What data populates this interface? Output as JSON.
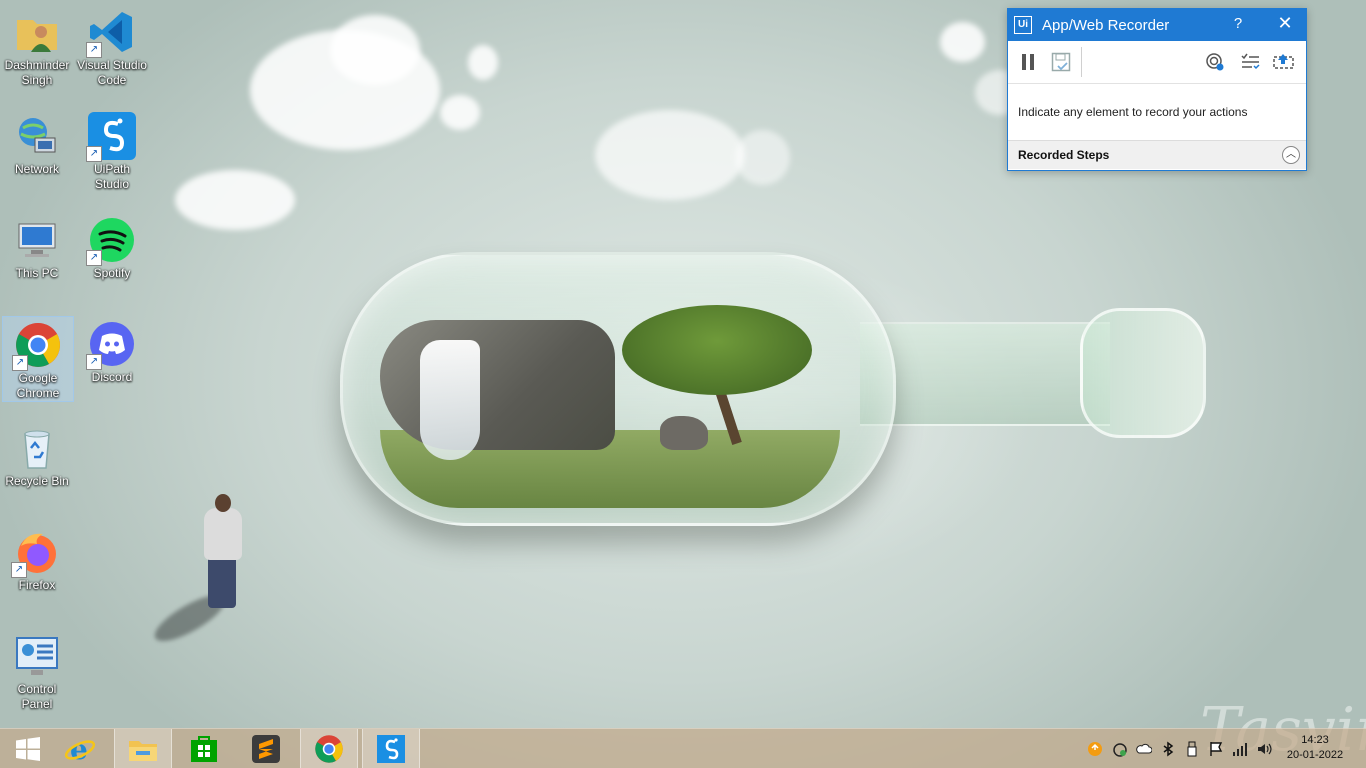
{
  "desktop": {
    "icons": [
      {
        "label": "Dashminder Singh",
        "icon": "user-folder-icon"
      },
      {
        "label": "Visual Studio Code",
        "icon": "vscode-icon"
      },
      {
        "label": "Network",
        "icon": "network-icon"
      },
      {
        "label": "UiPath Studio",
        "icon": "uipath-studio-icon"
      },
      {
        "label": "This PC",
        "icon": "this-pc-icon"
      },
      {
        "label": "Spotify",
        "icon": "spotify-icon"
      },
      {
        "label": "Google Chrome",
        "icon": "chrome-icon"
      },
      {
        "label": "Discord",
        "icon": "discord-icon"
      },
      {
        "label": "Recycle Bin",
        "icon": "recycle-bin-icon"
      },
      {
        "label": "Firefox",
        "icon": "firefox-icon"
      },
      {
        "label": "Control Panel",
        "icon": "control-panel-icon"
      }
    ],
    "selected_icon": "Google Chrome",
    "watermark": "Tasvir"
  },
  "recorder": {
    "title": "App/Web Recorder",
    "logo": "Ui",
    "help": "?",
    "close": "✕",
    "toolbar": [
      {
        "name": "pause",
        "icon": "pause-icon"
      },
      {
        "name": "save",
        "icon": "save-icon"
      },
      {
        "name": "target-settings",
        "icon": "target-icon"
      },
      {
        "name": "options",
        "icon": "list-options-icon"
      },
      {
        "name": "screen-selection",
        "icon": "screen-select-icon"
      }
    ],
    "message": "Indicate any element to record your actions",
    "recorded_steps_label": "Recorded Steps",
    "collapse": "︿",
    "accent": "#1f7ad3"
  },
  "taskbar": {
    "apps": [
      {
        "name": "start",
        "icon": "windows-start-icon"
      },
      {
        "name": "internet-explorer",
        "icon": "internet-explorer-icon"
      },
      {
        "name": "file-explorer",
        "icon": "file-explorer-icon"
      },
      {
        "name": "store",
        "icon": "store-icon"
      },
      {
        "name": "sublime-text",
        "icon": "sublime-text-icon"
      },
      {
        "name": "chrome",
        "icon": "chrome-icon"
      },
      {
        "name": "uipath",
        "icon": "uipath-icon"
      }
    ],
    "tray": [
      "update-icon",
      "security-icon",
      "onedrive-icon",
      "bluetooth-icon",
      "usb-icon",
      "flag-icon",
      "signal-icon",
      "volume-icon"
    ],
    "time": "14:23",
    "date": "20-01-2022"
  }
}
